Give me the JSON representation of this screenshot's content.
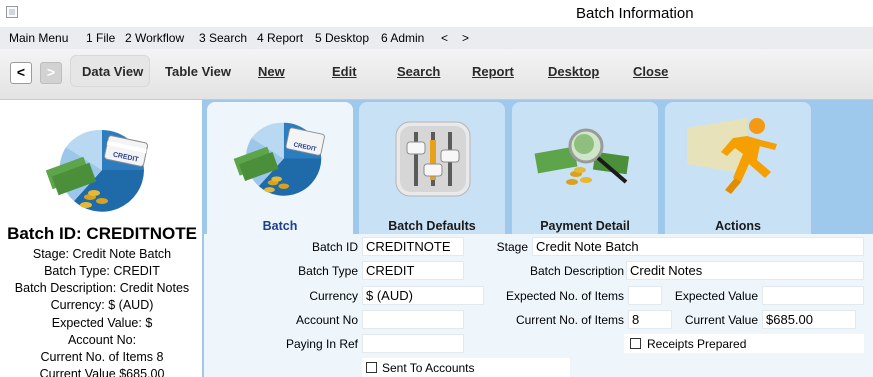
{
  "window": {
    "title": "Batch Information"
  },
  "menu": [
    "Main Menu",
    "1 File",
    "2 Workflow",
    "3 Search",
    "4 Report",
    "5 Desktop",
    "6 Admin",
    "<",
    ">"
  ],
  "toolbar": {
    "back": "<",
    "forward": ">",
    "data_view": "Data View",
    "table_view": "Table View",
    "new": "New",
    "edit": "Edit",
    "search": "Search",
    "report": "Report",
    "desktop": "Desktop",
    "close": "Close"
  },
  "summary": {
    "title": "Batch ID: CREDITNOTE",
    "lines": [
      "Stage: Credit Note Batch",
      "Batch Type: CREDIT",
      "Batch Description: Credit Notes",
      "Currency: $ (AUD)",
      "Expected Value: $",
      "Account No:",
      "Current No. of Items 8",
      "Current Value $685.00"
    ]
  },
  "tabs": [
    {
      "label": "Batch",
      "icon": "money-card-pie-icon"
    },
    {
      "label": "Batch Defaults",
      "icon": "mixer-sliders-icon"
    },
    {
      "label": "Payment Detail",
      "icon": "magnifier-money-icon"
    },
    {
      "label": "Actions",
      "icon": "running-man-icon"
    }
  ],
  "form": {
    "batch_id_label": "Batch ID",
    "batch_id": "CREDITNOTE",
    "stage_label": "Stage",
    "stage": "Credit Note Batch",
    "batch_type_label": "Batch Type",
    "batch_type": "CREDIT",
    "batch_desc_label": "Batch Description",
    "batch_desc": "Credit Notes",
    "currency_label": "Currency",
    "currency": "$ (AUD)",
    "expected_items_label": "Expected No. of Items",
    "expected_items": "",
    "expected_value_label": "Expected Value",
    "expected_value": "",
    "account_no_label": "Account No",
    "account_no": "",
    "current_items_label": "Current No. of Items",
    "current_items": "8",
    "current_value_label": "Current Value",
    "current_value": "$685.00",
    "paying_in_ref_label": "Paying In Ref",
    "paying_in_ref": "",
    "receipts_prepared_label": "Receipts Prepared",
    "sent_to_accounts_label": "Sent To Accounts"
  },
  "colors": {
    "tab_zone": "#9fc9ec",
    "tab_inactive": "#c9e1f4",
    "tab_active": "#eef5fb",
    "active_tab_text": "#1d3f8f"
  }
}
